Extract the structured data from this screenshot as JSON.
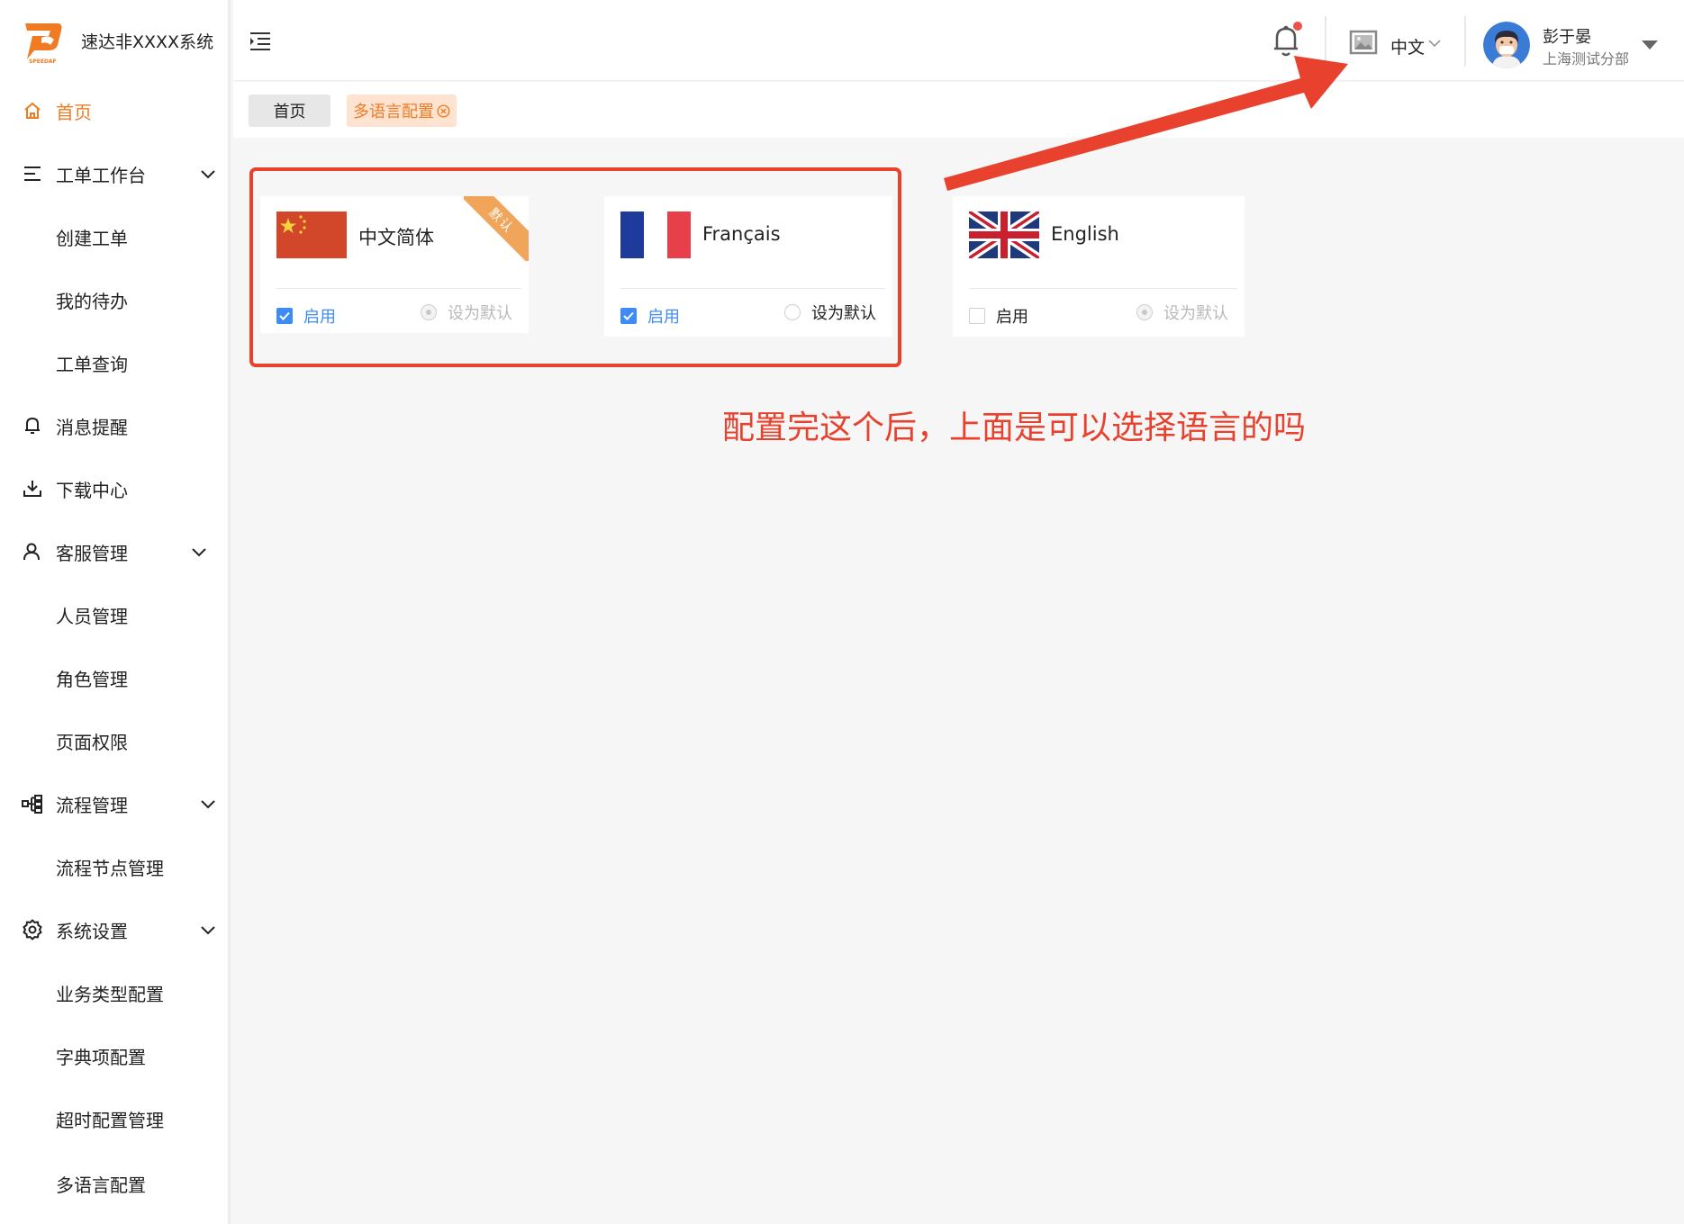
{
  "app": {
    "title": "速达非XXXX系统",
    "brand_color": "#f07b22"
  },
  "sidebar": {
    "items": [
      {
        "label": "首页",
        "icon": "home-icon",
        "active": true
      },
      {
        "label": "工单工作台",
        "icon": "menu-lines-icon",
        "expandable": true
      },
      {
        "label": "创建工单",
        "sub": true
      },
      {
        "label": "我的待办",
        "sub": true
      },
      {
        "label": "工单查询",
        "sub": true
      },
      {
        "label": "消息提醒",
        "icon": "bell-icon"
      },
      {
        "label": "下载中心",
        "icon": "download-icon"
      },
      {
        "label": "客服管理",
        "icon": "user-icon",
        "expandable": true
      },
      {
        "label": "人员管理",
        "sub": true
      },
      {
        "label": "角色管理",
        "sub": true
      },
      {
        "label": "页面权限",
        "sub": true
      },
      {
        "label": "流程管理",
        "icon": "flow-icon",
        "expandable": true
      },
      {
        "label": "流程节点管理",
        "sub": true
      },
      {
        "label": "系统设置",
        "icon": "gear-icon",
        "expandable": true
      },
      {
        "label": "业务类型配置",
        "sub": true
      },
      {
        "label": "字典项配置",
        "sub": true
      },
      {
        "label": "超时配置管理",
        "sub": true
      },
      {
        "label": "多语言配置",
        "sub": true
      }
    ]
  },
  "header": {
    "language": "中文",
    "user_name": "彭于晏",
    "user_dept": "上海测试分部"
  },
  "tabs": [
    {
      "label": "首页"
    },
    {
      "label": "多语言配置",
      "closable": true
    }
  ],
  "languages": [
    {
      "name": "中文简体",
      "flag": "china-flag-icon",
      "enabled": true,
      "enabled_label": "启用",
      "set_default_label": "设为默认",
      "is_default": true,
      "default_badge": "默认"
    },
    {
      "name": "Français",
      "flag": "france-flag-icon",
      "enabled": true,
      "enabled_label": "启用",
      "set_default_label": "设为默认",
      "is_default": false
    },
    {
      "name": "English",
      "flag": "uk-flag-icon",
      "enabled": false,
      "enabled_label": "启用",
      "set_default_label": "设为默认",
      "is_default": false
    }
  ],
  "annotation": {
    "text": "配置完这个后，上面是可以选择语言的吗",
    "color": "#e8412d"
  }
}
